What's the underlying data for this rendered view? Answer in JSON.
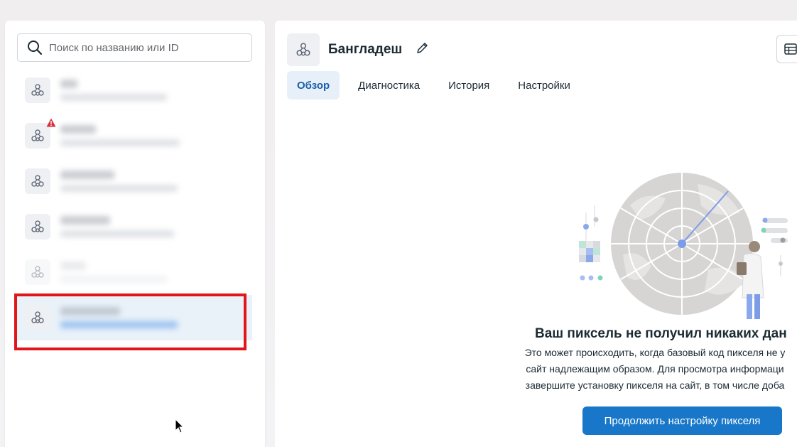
{
  "search": {
    "placeholder": "Поиск по названию или ID",
    "value": ""
  },
  "pixel_list": {
    "items": [
      {
        "icon": "pixel-network-icon",
        "warning": false,
        "faded": false,
        "selected": false
      },
      {
        "icon": "pixel-network-icon",
        "warning": true,
        "faded": false,
        "selected": false
      },
      {
        "icon": "pixel-network-icon",
        "warning": false,
        "faded": false,
        "selected": false
      },
      {
        "icon": "pixel-network-icon",
        "warning": false,
        "faded": false,
        "selected": false
      },
      {
        "icon": "pixel-network-icon",
        "warning": false,
        "faded": true,
        "selected": false
      },
      {
        "icon": "pixel-network-icon",
        "warning": false,
        "faded": false,
        "selected": true
      }
    ]
  },
  "header": {
    "title": "Бангладеш"
  },
  "tabs": [
    {
      "label": "Обзор",
      "active": true
    },
    {
      "label": "Диагностика",
      "active": false
    },
    {
      "label": "История",
      "active": false
    },
    {
      "label": "Настройки",
      "active": false
    }
  ],
  "empty_state": {
    "title": "Ваш пиксель не получил никаких дан",
    "description_lines": [
      "Это может происходить, когда базовый код пикселя не у",
      "сайт надлежащим образом. Для просмотра информаци",
      "завершите установку пикселя на сайт, в том числе доба"
    ],
    "button_label": "Продолжить настройку пикселя"
  },
  "colors": {
    "accent": "#1877c9",
    "highlight": "#e0161b",
    "warning": "#d6313c"
  }
}
